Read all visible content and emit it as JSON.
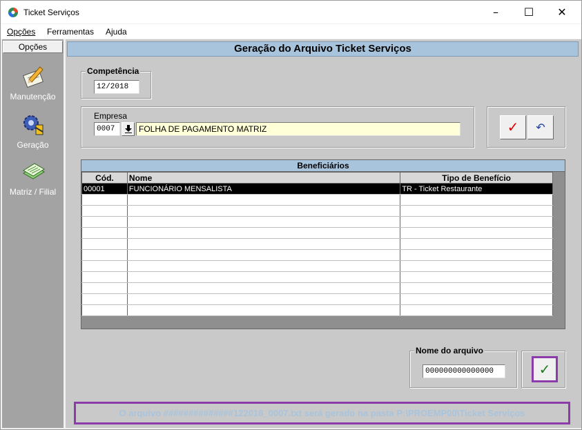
{
  "window": {
    "title": "Ticket Serviços",
    "minimize": "–",
    "maximize": "☐",
    "close": "✕"
  },
  "menu": {
    "items": [
      {
        "label": "Opções",
        "accel": "O"
      },
      {
        "label": "Ferramentas",
        "accel": "F"
      },
      {
        "label": "Ajuda",
        "accel": "A"
      }
    ]
  },
  "sidebar": {
    "header": "Opções",
    "items": [
      {
        "label": "Manutenção",
        "icon": "pencil-notepad-icon"
      },
      {
        "label": "Geração",
        "icon": "gear-icon"
      },
      {
        "label": "Matriz / Filial",
        "icon": "stacked-papers-icon"
      }
    ]
  },
  "main": {
    "banner": "Geração do Arquivo Ticket Serviços",
    "competencia": {
      "legend": "Competência",
      "value": "12/2018"
    },
    "empresa": {
      "label": "Empresa",
      "code": "0007",
      "name": "FOLHA DE PAGAMENTO MATRIZ"
    },
    "actions": {
      "confirm": "✓",
      "undo": "↶"
    },
    "beneficiarios": {
      "title": "Beneficiários",
      "columns": [
        "Cód.",
        "Nome",
        "Tipo de Benefício"
      ],
      "rows": [
        [
          "00001",
          "FUNCIONÁRIO MENSALISTA",
          "TR - Ticket Restaurante"
        ]
      ]
    },
    "arquivo": {
      "legend": "Nome do arquivo",
      "value": "000000000000000",
      "generate": "✓"
    },
    "status": "O arquivo ##############122018_0007.txt será gerado na pasta P:\\PROEMP00\\Ticket Serviços"
  },
  "colors": {
    "banner": "#a8c4dd",
    "highlight_border": "#8c3bab",
    "selected_row": "#000000",
    "confirm_red": "#e00000",
    "generate_green": "#1f7a1f"
  }
}
